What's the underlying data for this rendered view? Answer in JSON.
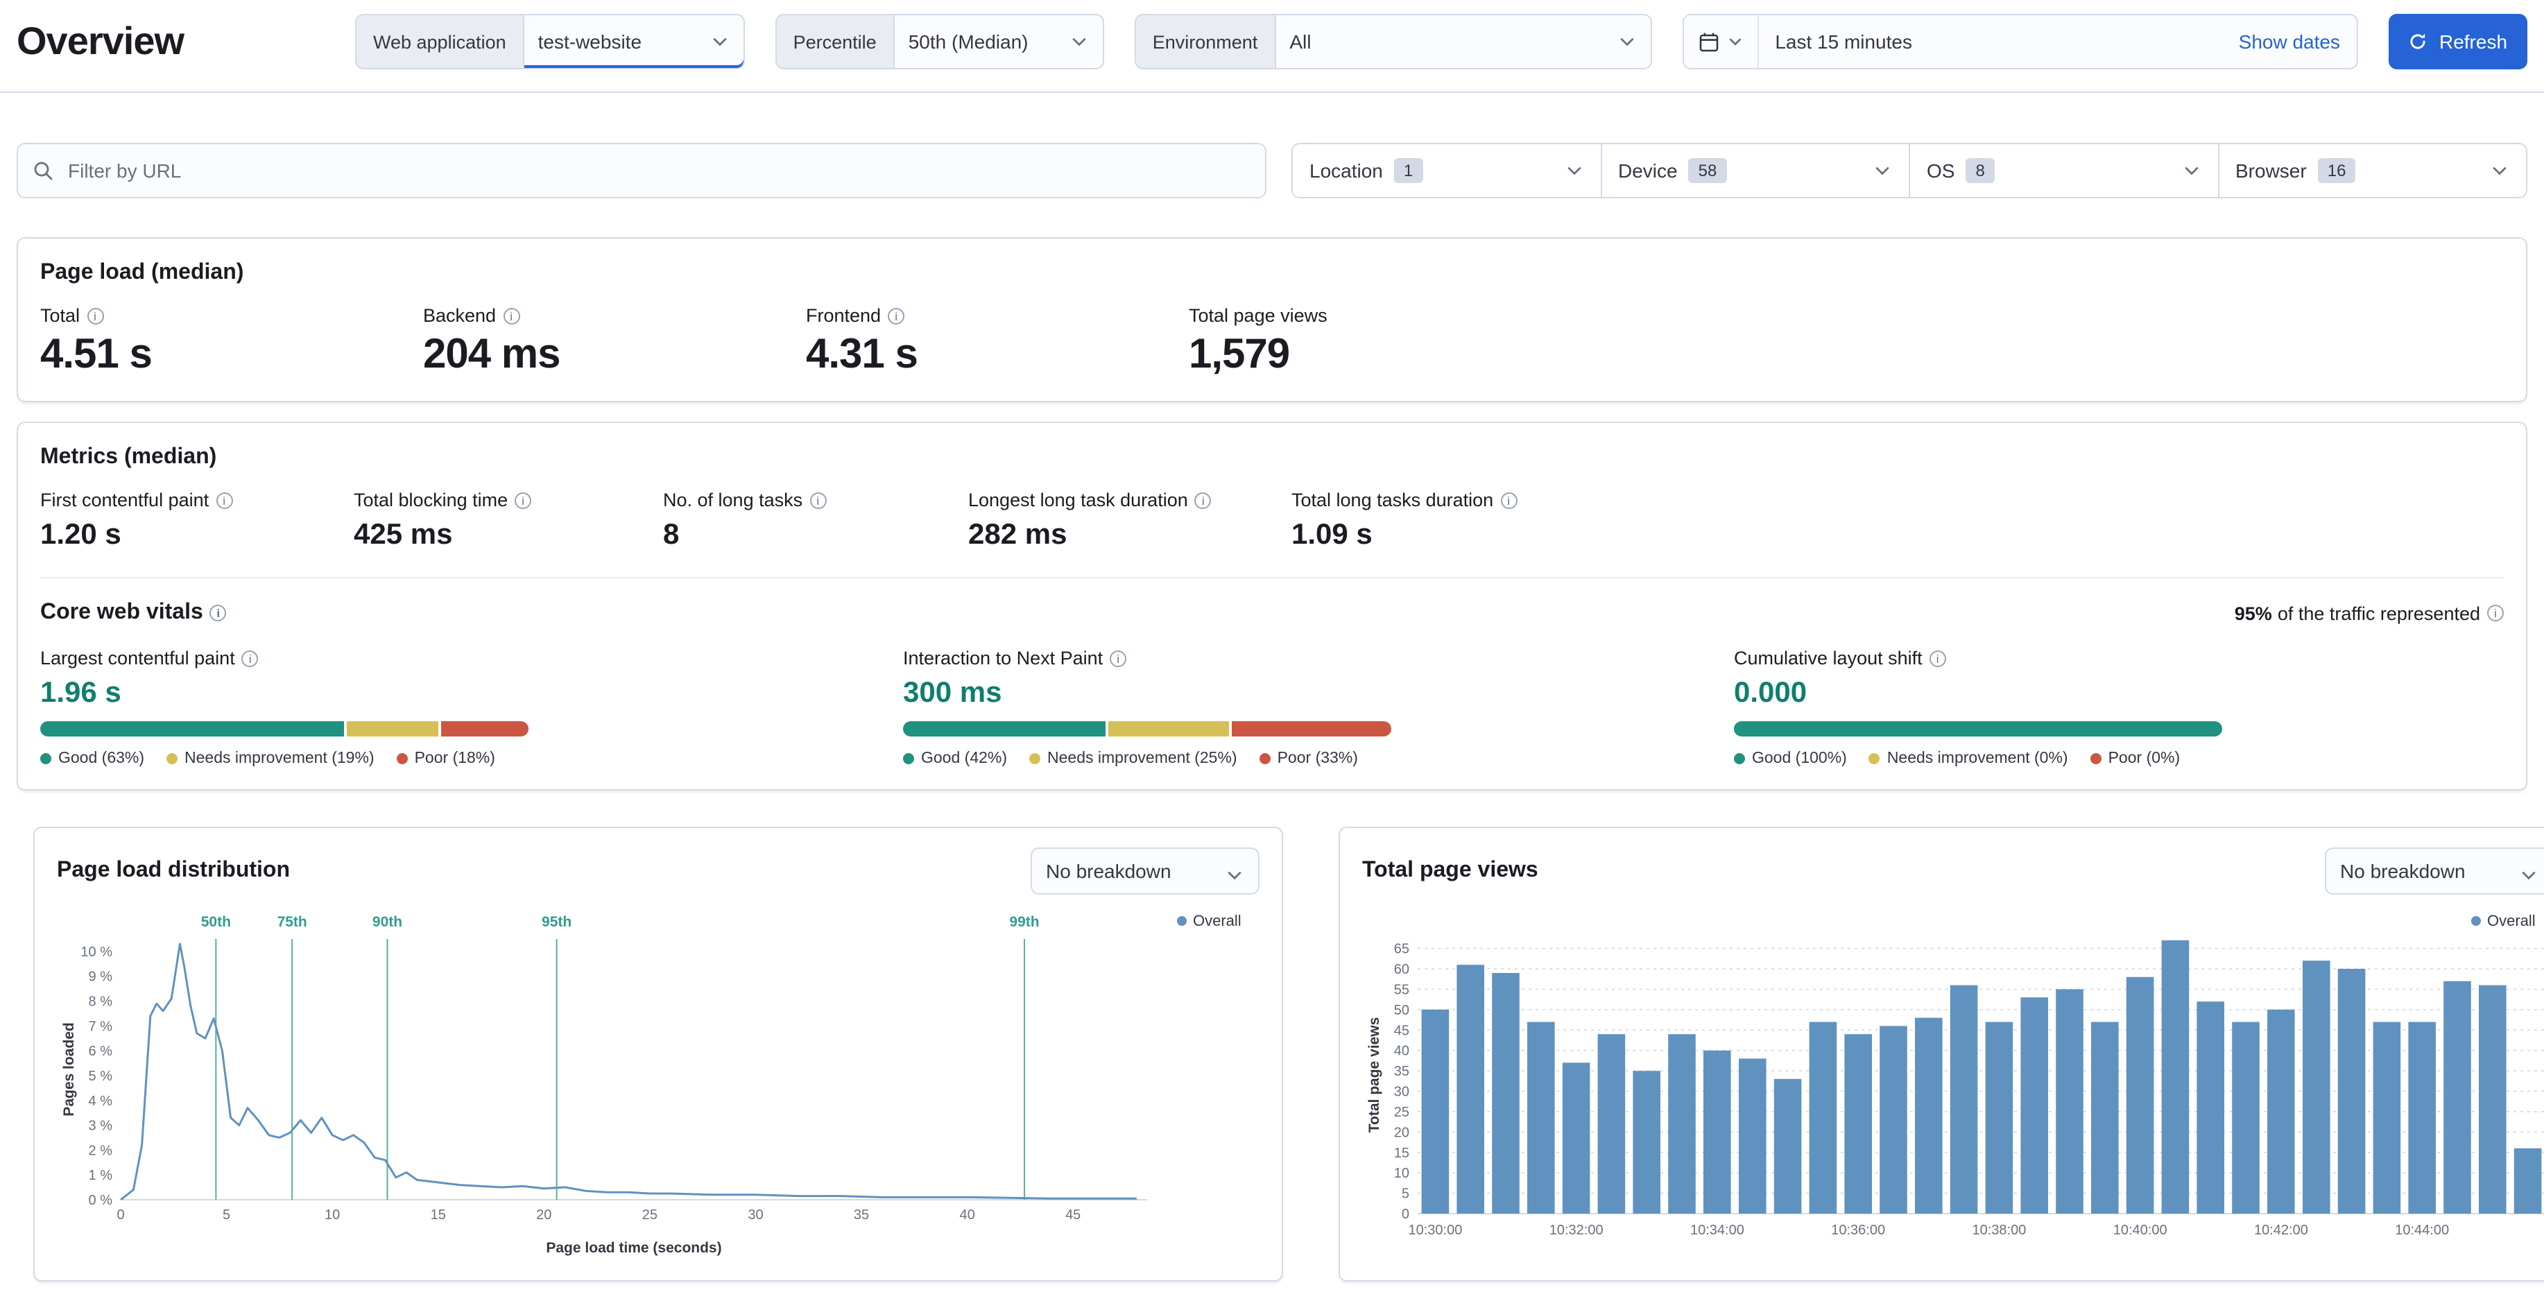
{
  "page": {
    "title": "Overview"
  },
  "toolbar": {
    "web_application": {
      "label": "Web application",
      "value": "test-website"
    },
    "percentile": {
      "label": "Percentile",
      "value": "50th (Median)"
    },
    "environment": {
      "label": "Environment",
      "value": "All"
    },
    "time_range": "Last 15 minutes",
    "show_dates_label": "Show dates",
    "refresh_label": "Refresh"
  },
  "filters": {
    "url_filter_placeholder": "Filter by URL",
    "facets": [
      {
        "label": "Location",
        "count": "1"
      },
      {
        "label": "Device",
        "count": "58"
      },
      {
        "label": "OS",
        "count": "8"
      },
      {
        "label": "Browser",
        "count": "16"
      }
    ]
  },
  "page_load": {
    "title": "Page load (median)",
    "stats": [
      {
        "label": "Total",
        "value": "4.51 s"
      },
      {
        "label": "Backend",
        "value": "204 ms"
      },
      {
        "label": "Frontend",
        "value": "4.31 s"
      },
      {
        "label": "Total page views",
        "value": "1,579"
      }
    ]
  },
  "metrics": {
    "title": "Metrics (median)",
    "stats": [
      {
        "label": "First contentful paint",
        "value": "1.20 s"
      },
      {
        "label": "Total blocking time",
        "value": "425 ms"
      },
      {
        "label": "No. of long tasks",
        "value": "8"
      },
      {
        "label": "Longest long task duration",
        "value": "282 ms"
      },
      {
        "label": "Total long tasks duration",
        "value": "1.09 s"
      }
    ]
  },
  "core_web_vitals": {
    "title": "Core web vitals",
    "traffic_percent": "95%",
    "traffic_text": "of the traffic represented",
    "vitals": [
      {
        "label": "Largest contentful paint",
        "value": "1.96 s",
        "segments": [
          63,
          19,
          18
        ],
        "legend": [
          "Good (63%)",
          "Needs improvement (19%)",
          "Poor (18%)"
        ]
      },
      {
        "label": "Interaction to Next Paint",
        "value": "300 ms",
        "segments": [
          42,
          25,
          33
        ],
        "legend": [
          "Good (42%)",
          "Needs improvement (25%)",
          "Poor (33%)"
        ]
      },
      {
        "label": "Cumulative layout shift",
        "value": "0.000",
        "segments": [
          100,
          0,
          0
        ],
        "legend": [
          "Good (100%)",
          "Needs improvement (0%)",
          "Poor (0%)"
        ]
      }
    ]
  },
  "breakdown": {
    "label": "No breakdown"
  },
  "chart_data": [
    {
      "type": "line",
      "title": "Page load distribution",
      "xlabel": "Page load time (seconds)",
      "ylabel": "Pages loaded",
      "xlim": [
        0,
        48.5
      ],
      "ylim": [
        0,
        10.5
      ],
      "x_ticks": [
        0,
        5,
        10,
        15,
        20,
        25,
        30,
        35,
        40,
        45
      ],
      "y_ticks": [
        0,
        1,
        2,
        3,
        4,
        5,
        6,
        7,
        8,
        9,
        10
      ],
      "y_tick_suffix": " %",
      "legend": [
        "Overall"
      ],
      "percentile_markers": [
        {
          "label": "50th",
          "x": 4.5
        },
        {
          "label": "75th",
          "x": 8.1
        },
        {
          "label": "90th",
          "x": 12.6
        },
        {
          "label": "95th",
          "x": 20.6
        },
        {
          "label": "99th",
          "x": 42.7
        }
      ],
      "series": [
        {
          "name": "Overall",
          "x": [
            0,
            0.6,
            1,
            1.4,
            1.7,
            2,
            2.4,
            2.8,
            3,
            3.3,
            3.6,
            4,
            4.4,
            4.8,
            5.2,
            5.6,
            6,
            6.5,
            7,
            7.5,
            8,
            8.5,
            9,
            9.5,
            10,
            10.5,
            11,
            11.5,
            12,
            12.5,
            13,
            13.5,
            14,
            15,
            16,
            17,
            18,
            19,
            20,
            21,
            22,
            23,
            24,
            25,
            26,
            28,
            30,
            32,
            34,
            36,
            38,
            40,
            42,
            44,
            46,
            48
          ],
          "y": [
            0,
            0.4,
            2.2,
            7.4,
            7.9,
            7.6,
            8.1,
            10.3,
            9.4,
            7.8,
            6.7,
            6.5,
            7.3,
            6,
            3.3,
            3,
            3.7,
            3.2,
            2.6,
            2.5,
            2.7,
            3.2,
            2.7,
            3.3,
            2.6,
            2.4,
            2.6,
            2.3,
            1.7,
            1.6,
            0.9,
            1.1,
            0.8,
            0.7,
            0.6,
            0.55,
            0.5,
            0.55,
            0.45,
            0.5,
            0.35,
            0.3,
            0.3,
            0.25,
            0.25,
            0.2,
            0.2,
            0.15,
            0.15,
            0.1,
            0.1,
            0.1,
            0.08,
            0.05,
            0.05,
            0.05
          ]
        }
      ]
    },
    {
      "type": "bar",
      "title": "Total page views",
      "xlabel": "",
      "ylabel": "Total page views",
      "ylim": [
        0,
        68
      ],
      "y_ticks": [
        0,
        5,
        10,
        15,
        20,
        25,
        30,
        35,
        40,
        45,
        50,
        55,
        60,
        65
      ],
      "x_tick_every": 4,
      "legend": [
        "Overall"
      ],
      "categories": [
        "10:30:00",
        "10:30:30",
        "10:31:00",
        "10:31:30",
        "10:32:00",
        "10:32:30",
        "10:33:00",
        "10:33:30",
        "10:34:00",
        "10:34:30",
        "10:35:00",
        "10:35:30",
        "10:36:00",
        "10:36:30",
        "10:37:00",
        "10:37:30",
        "10:38:00",
        "10:38:30",
        "10:39:00",
        "10:39:30",
        "10:40:00",
        "10:40:30",
        "10:41:00",
        "10:41:30",
        "10:42:00",
        "10:42:30",
        "10:43:00",
        "10:43:30",
        "10:44:00",
        "10:44:30",
        "10:45:00",
        "10:45:30"
      ],
      "values": [
        50,
        61,
        59,
        47,
        37,
        44,
        35,
        44,
        40,
        38,
        33,
        47,
        44,
        46,
        48,
        56,
        47,
        53,
        55,
        47,
        58,
        67,
        52,
        47,
        50,
        62,
        60,
        47,
        47,
        57,
        56,
        16
      ]
    }
  ],
  "colors": {
    "good": "#209280",
    "needs_improvement": "#d6bf57",
    "poor": "#cc5642",
    "primary": "#2563d6",
    "series": "#6092c0",
    "percentile_line": "#54b399",
    "percentile_text": "#2f9e8b",
    "value_teal": "#107e6e"
  }
}
